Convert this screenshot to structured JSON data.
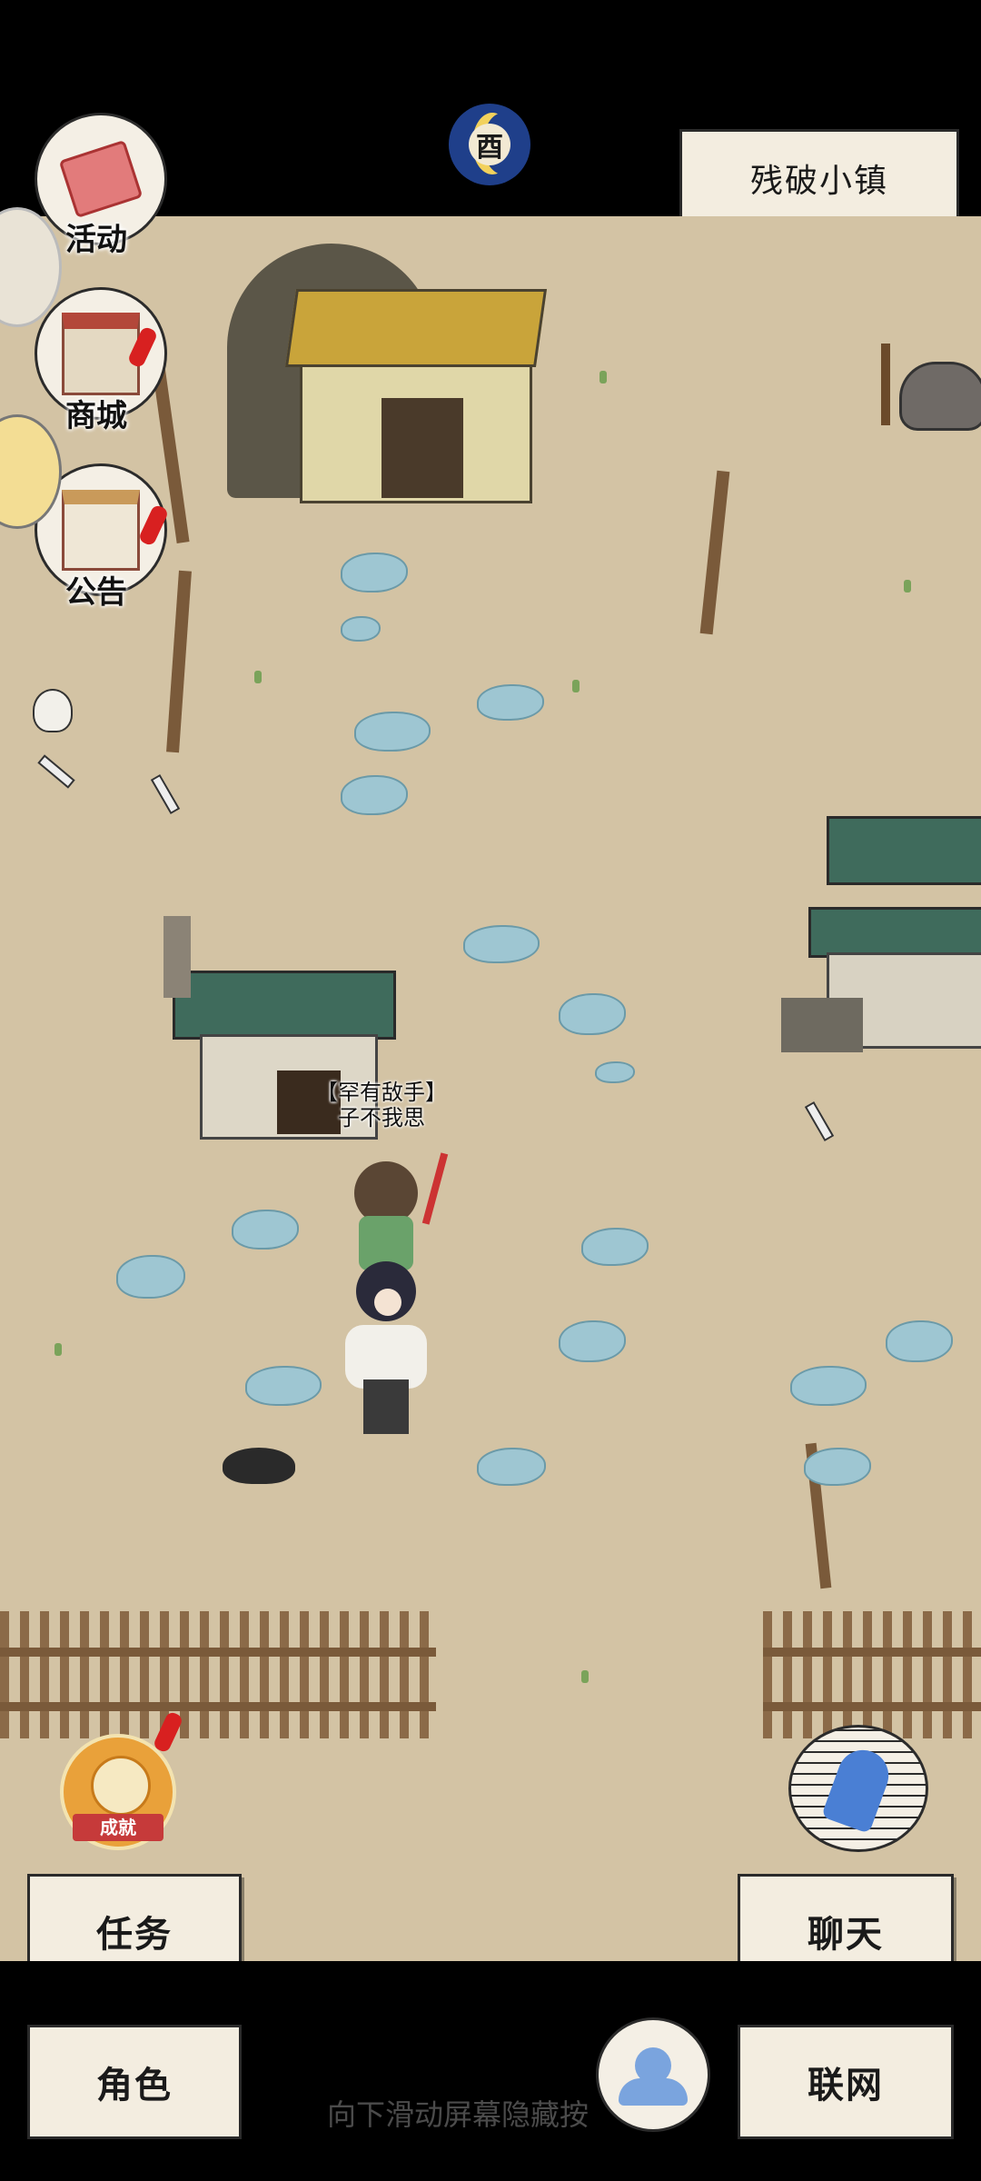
{
  "location": {
    "title": "残破小镇"
  },
  "time": {
    "badge": "酉"
  },
  "left_menu": [
    {
      "label": "活动",
      "icon": "activity-flag-icon"
    },
    {
      "label": "商城",
      "icon": "shop-stall-icon"
    },
    {
      "label": "公告",
      "icon": "notice-board-icon"
    }
  ],
  "map": {
    "npc_tag_line1": "【罕有敌手】",
    "npc_tag_line2": "子不我思"
  },
  "achievement": {
    "label": "成就"
  },
  "buttons": {
    "quest": "任务",
    "chat": "聊天",
    "role": "角色",
    "online": "联网"
  },
  "hint": {
    "text": "向下滑动屏幕隐藏按"
  },
  "colors": {
    "ground": "#d3c3a4",
    "stone": "#9ec6d2",
    "paper": "#f3ede0",
    "alert": "#d82020"
  }
}
